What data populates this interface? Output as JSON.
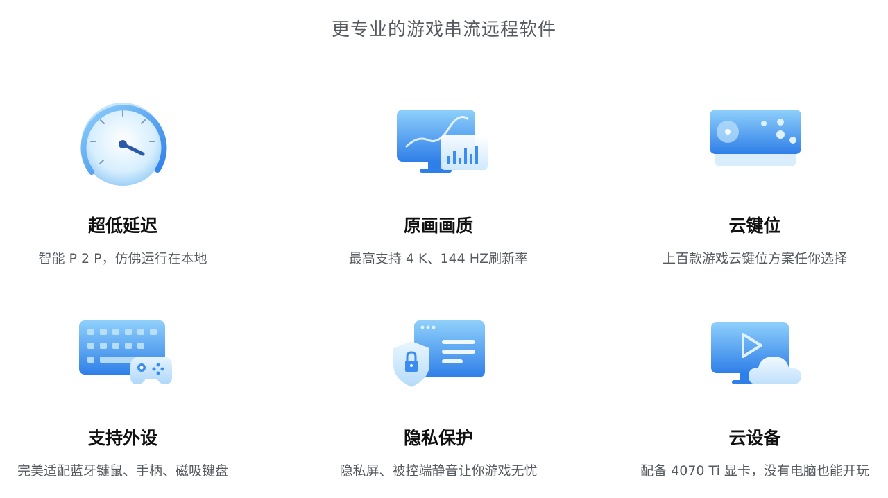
{
  "header": {
    "subtitle": "更专业的游戏串流远程软件"
  },
  "features": [
    {
      "title": "超低延迟",
      "desc": "智能 P 2 P，仿佛运行在本地",
      "icon": "speedometer-icon"
    },
    {
      "title": "原画画质",
      "desc": "最高支持 4 K、144 HZ刷新率",
      "icon": "monitor-chart-icon"
    },
    {
      "title": "云键位",
      "desc": "上百款游戏云键位方案任你选择",
      "icon": "gamepad-panel-icon"
    },
    {
      "title": "支持外设",
      "desc": "完美适配蓝牙键鼠、手柄、磁吸键盘",
      "icon": "keyboard-controller-icon"
    },
    {
      "title": "隐私保护",
      "desc": "隐私屏、被控端静音让你游戏无忧",
      "icon": "shield-lock-icon"
    },
    {
      "title": "云设备",
      "desc": "配备 4070 Ti 显卡，没有电脑也能开玩",
      "icon": "cloud-monitor-icon"
    }
  ],
  "colors": {
    "accent": "#3b8cf0",
    "accent_light": "#bfe3fb",
    "text_primary": "#111111",
    "text_secondary": "#555a60"
  }
}
